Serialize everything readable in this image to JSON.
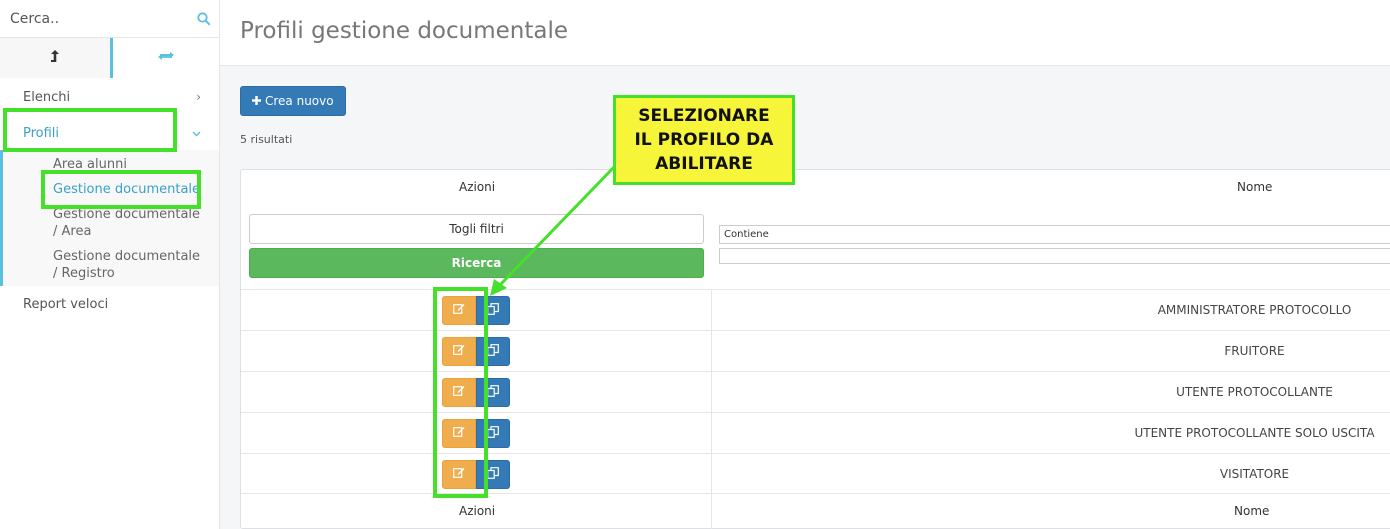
{
  "sidebar": {
    "search": {
      "placeholder": "Cerca.."
    },
    "nav": {
      "elenchi": "Elenchi",
      "profili": "Profili",
      "report": "Report veloci"
    },
    "sub": {
      "area_alunni": "Area alunni",
      "gestione_documentale": "Gestione documentale",
      "gd_area_1": "Gestione documentale",
      "gd_area_2": "/ Area",
      "gd_registro_1": "Gestione documentale",
      "gd_registro_2": "/ Registro"
    }
  },
  "main": {
    "title": "Profili gestione documentale",
    "create_button": "Crea nuovo",
    "results": "5 risultati",
    "table": {
      "col_actions": "Azioni",
      "col_name": "Nome",
      "clear_filters": "Togli filtri",
      "search_button": "Ricerca",
      "filter_mode": "Contiene",
      "rows": [
        "AMMINISTRATORE PROTOCOLLO",
        "FRUITORE",
        "UTENTE PROTOCOLLANTE",
        "UTENTE PROTOCOLLANTE SOLO USCITA",
        "VISITATORE"
      ],
      "footer_actions": "Azioni",
      "footer_name": "Nome"
    }
  },
  "annotation": {
    "line1": "SELEZIONARE",
    "line2": "IL PROFILO DA",
    "line3": "ABILITARE",
    "color": "#44e02a",
    "callout_bg": "#f7f53a"
  },
  "colors": {
    "primary": "#337ab7",
    "success": "#5cb85c",
    "warning": "#f0ad4e",
    "accent": "#5bc0de"
  },
  "icons": [
    "search-icon",
    "upload-arrow-icon",
    "sync-icon",
    "chevron-right-icon",
    "chevron-down-icon",
    "plus-icon",
    "edit-icon",
    "copy-icon"
  ]
}
